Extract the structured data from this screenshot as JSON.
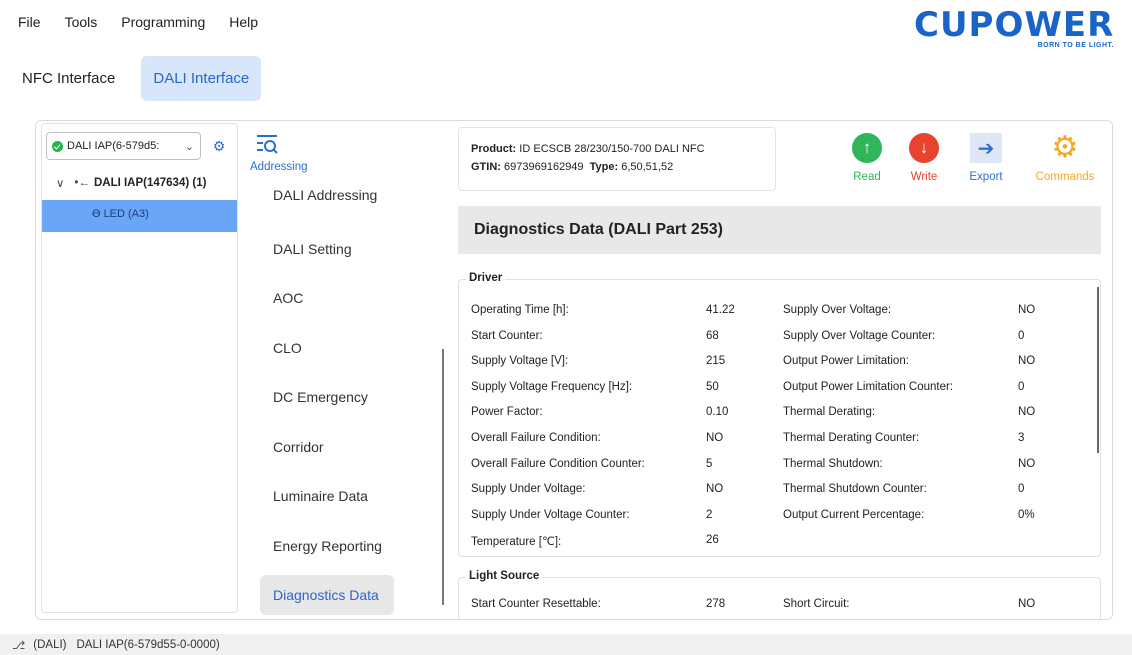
{
  "menu": [
    "File",
    "Tools",
    "Programming",
    "Help"
  ],
  "logo": {
    "brand": "CUPOWER",
    "tagline": "BORN TO BE LIGHT."
  },
  "tabs": [
    {
      "label": "NFC Interface",
      "active": false
    },
    {
      "label": "DALI Interface",
      "active": true
    }
  ],
  "tree": {
    "device_select": "DALI IAP(6-579d5:",
    "root": "DALI IAP(147634) (1)",
    "leaf": "LED (A3)"
  },
  "addressing": {
    "label": "Addressing"
  },
  "nav": [
    {
      "label": "DALI Addressing",
      "active": false
    },
    {
      "label": "DALI Setting",
      "active": false
    },
    {
      "label": "AOC",
      "active": false
    },
    {
      "label": "CLO",
      "active": false
    },
    {
      "label": "DC Emergency",
      "active": false
    },
    {
      "label": "Corridor",
      "active": false
    },
    {
      "label": "Luminaire Data",
      "active": false
    },
    {
      "label": "Energy Reporting",
      "active": false
    },
    {
      "label": "Diagnostics Data",
      "active": true
    }
  ],
  "product": {
    "product_label": "Product:",
    "product_value": "ID ECSCB 28/230/150-700 DALI NFC",
    "gtin_label": "GTIN:",
    "gtin_value": "6973969162949",
    "type_label": "Type:",
    "type_value": "6,50,51,52"
  },
  "toolbar": [
    {
      "label": "Read",
      "icon": "arrow-up-icon",
      "color": "#2fb55a"
    },
    {
      "label": "Write",
      "icon": "arrow-down-icon",
      "color": "#e8432e"
    },
    {
      "label": "Export",
      "icon": "arrow-right-icon",
      "color": "#2f6fd8"
    },
    {
      "label": "Commands",
      "icon": "gear-icon",
      "color": "#f5a623"
    }
  ],
  "diagnostics": {
    "title": "Diagnostics Data (DALI Part 253)",
    "driver": {
      "title": "Driver",
      "rows": [
        [
          "Operating Time [h]:",
          "41.22",
          "Supply Over Voltage:",
          "NO"
        ],
        [
          "Start Counter:",
          "68",
          "Supply Over Voltage Counter:",
          "0"
        ],
        [
          "Supply Voltage [V]:",
          "215",
          "Output Power Limitation:",
          "NO"
        ],
        [
          "Supply Voltage Frequency [Hz]:",
          "50",
          "Output Power Limitation Counter:",
          "0"
        ],
        [
          "Power Factor:",
          "0.10",
          "Thermal Derating:",
          "NO"
        ],
        [
          "Overall Failure Condition:",
          "NO",
          "Thermal Derating Counter:",
          "3"
        ],
        [
          "Overall Failure Condition Counter:",
          "5",
          "Thermal Shutdown:",
          "NO"
        ],
        [
          "Supply Under Voltage:",
          "NO",
          "Thermal Shutdown Counter:",
          "0"
        ],
        [
          "Supply Under Voltage Counter:",
          "2",
          "Output Current Percentage:",
          "0%"
        ],
        [
          "Temperature [℃]:",
          "26",
          "",
          ""
        ]
      ]
    },
    "light_source": {
      "title": "Light Source",
      "rows": [
        [
          "Start Counter Resettable:",
          "278",
          "Short Circuit:",
          "NO"
        ]
      ]
    }
  },
  "status": {
    "protocol": "(DALI)",
    "device": "DALI IAP(6-579d55-0-0000)"
  }
}
